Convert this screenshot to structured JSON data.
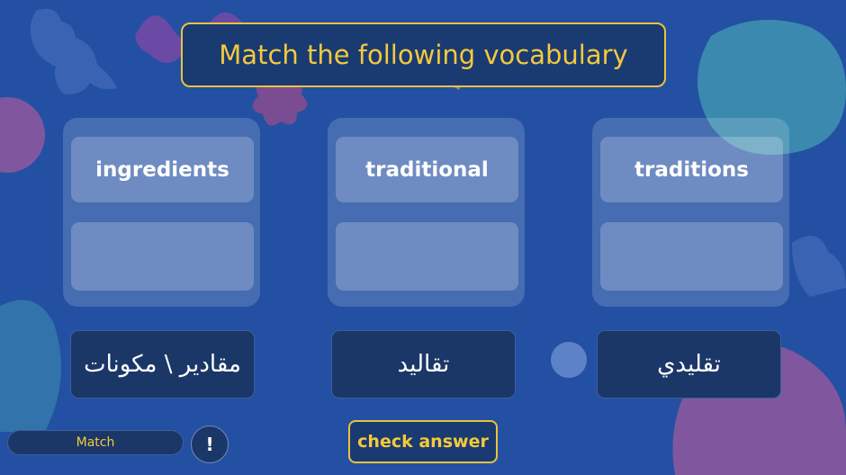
{
  "title": "Match the following vocabulary",
  "columns": [
    {
      "word": "ingredients"
    },
    {
      "word": "traditional"
    },
    {
      "word": "traditions"
    }
  ],
  "cards": [
    {
      "text": "مقادير \\ مكونات"
    },
    {
      "text": "تقاليد"
    },
    {
      "text": "تقليدي"
    }
  ],
  "footer": {
    "mode_label": "Match",
    "info_label": "!",
    "check_label": "check answer"
  },
  "colors": {
    "background": "#2350a3",
    "accent": "#f4c93b",
    "card": "#1b3768"
  }
}
